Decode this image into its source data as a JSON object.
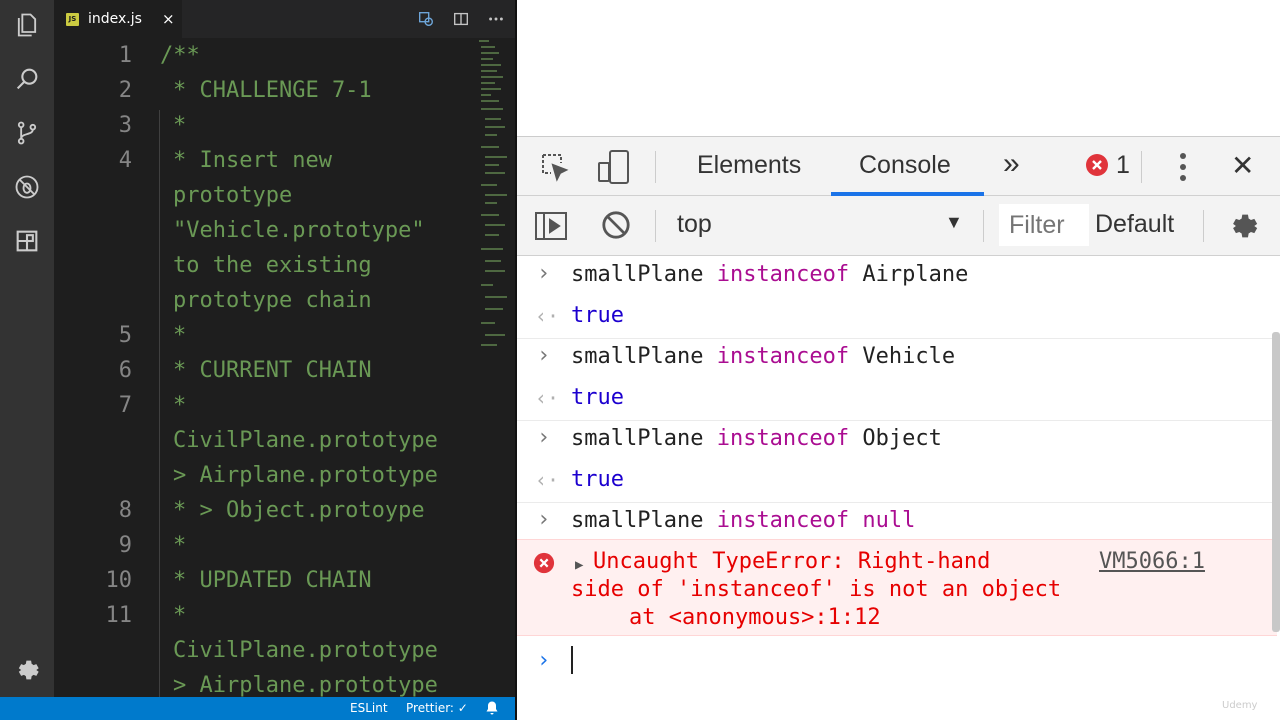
{
  "editor": {
    "tab": {
      "badge": "JS",
      "filename": "index.js",
      "close": "×"
    },
    "lines": [
      {
        "number": "1",
        "text": "/**"
      },
      {
        "number": "2",
        "text": "* CHALLENGE 7-1"
      },
      {
        "number": "3",
        "text": "*"
      },
      {
        "number": "4",
        "text": "* Insert new"
      },
      {
        "number": "",
        "text": "prototype"
      },
      {
        "number": "",
        "text": "\"Vehicle.prototype\""
      },
      {
        "number": "",
        "text": "to the existing"
      },
      {
        "number": "",
        "text": "prototype chain"
      },
      {
        "number": "5",
        "text": "*"
      },
      {
        "number": "6",
        "text": "* CURRENT CHAIN"
      },
      {
        "number": "7",
        "text": "*"
      },
      {
        "number": "",
        "text": "CivilPlane.prototype"
      },
      {
        "number": "",
        "text": "> Airplane.prototype"
      },
      {
        "number": "8",
        "text": "* > Object.protoype"
      },
      {
        "number": "9",
        "text": "*"
      },
      {
        "number": "10",
        "text": "* UPDATED CHAIN"
      },
      {
        "number": "11",
        "text": "*"
      },
      {
        "number": "",
        "text": "CivilPlane.prototype"
      },
      {
        "number": "",
        "text": "> Airplane.prototype"
      }
    ]
  },
  "status_bar": {
    "eslint": "ESLint",
    "prettier": "Prettier: ✓"
  },
  "devtools": {
    "tabs": {
      "elements": "Elements",
      "console": "Console",
      "more": "»"
    },
    "error_count": "1",
    "close": "✕",
    "console_bar": {
      "context": "top",
      "filter_placeholder": "Filter",
      "levels": "Default"
    },
    "entries": [
      {
        "object": "smallPlane",
        "operator": "instanceof",
        "target": "Airplane",
        "result": "true"
      },
      {
        "object": "smallPlane",
        "operator": "instanceof",
        "target": "Vehicle",
        "result": "true"
      },
      {
        "object": "smallPlane",
        "operator": "instanceof",
        "target": "Object",
        "result": "true"
      },
      {
        "object": "smallPlane",
        "operator": "instanceof",
        "target": "null"
      }
    ],
    "error": {
      "line1": "Uncaught TypeError: Right-hand",
      "line2": "side of 'instanceof' is not an object",
      "line3": "at <anonymous>:1:12",
      "source_link": "VM5066:1"
    },
    "prompt_symbol": "›"
  },
  "colors": {
    "editor_bg": "#1e1e1e",
    "comment": "#6a9955",
    "status_bar": "#007acc",
    "console_tab_underline": "#1a73e8",
    "keyword": "#aa0d91",
    "boolean": "#1c00cf",
    "error_text": "#e60000",
    "error_bg": "#fff0f0"
  },
  "watermark": "Udemy"
}
